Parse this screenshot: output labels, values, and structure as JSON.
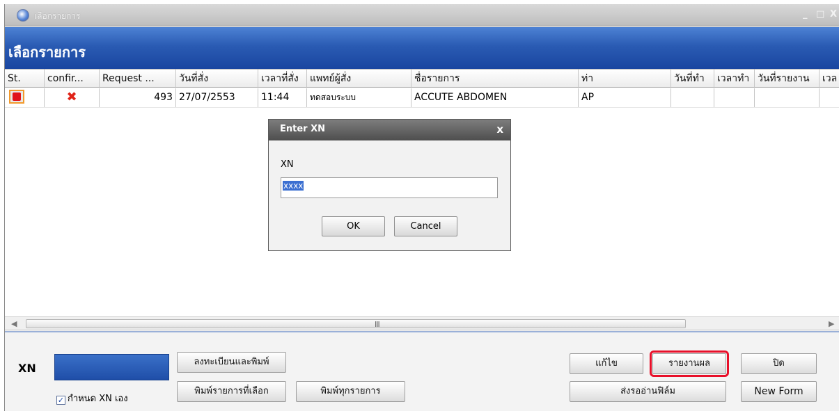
{
  "window": {
    "title": "เลือกรายการ",
    "heading": "เลือกรายการ",
    "controls": [
      "_",
      "□",
      "X"
    ]
  },
  "grid": {
    "columns": [
      {
        "label": "St.",
        "w": 57
      },
      {
        "label": "confir...",
        "w": 79
      },
      {
        "label": "Request ...",
        "w": 110
      },
      {
        "label": "วันที่สั่ง",
        "w": 118
      },
      {
        "label": "เวลาที่สั่ง",
        "w": 70
      },
      {
        "label": "แพทย์ผู้สั่ง",
        "w": 150
      },
      {
        "label": "ชื่อรายการ",
        "w": 240
      },
      {
        "label": "ท่า",
        "w": 133
      },
      {
        "label": "วันที่ทำ",
        "w": 62
      },
      {
        "label": "เวลาทำ",
        "w": 58
      },
      {
        "label": "วันที่รายงาน",
        "w": 93
      },
      {
        "label": "เวล",
        "w": 40
      }
    ],
    "rows": [
      {
        "request": "493",
        "date": "27/07/2553",
        "time": "11:44",
        "doctor": "ทดสอบระบบ",
        "item": "ACCUTE ABDOMEN",
        "pose": "AP"
      }
    ]
  },
  "scrollbar": {
    "left": "◀",
    "right": "▶",
    "grip": "III"
  },
  "footer": {
    "xn_label": "XN",
    "checkbox_label": "กำหนด XN เอง",
    "buttons": {
      "register_print": "ลงทะเบียนและพิมพ์",
      "print_selected": "พิมพ์รายการที่เลือก",
      "print_all": "พิมพ์ทุกรายการ",
      "edit": "แก้ไข",
      "report": "รายงานผล",
      "close": "ปิด",
      "send_film": "ส่งรออ่านฟิล์ม",
      "new_form": "New Form"
    }
  },
  "dialog": {
    "title": "Enter XN",
    "close": "x",
    "label": "XN",
    "value": "xxxx",
    "ok": "OK",
    "cancel": "Cancel"
  }
}
